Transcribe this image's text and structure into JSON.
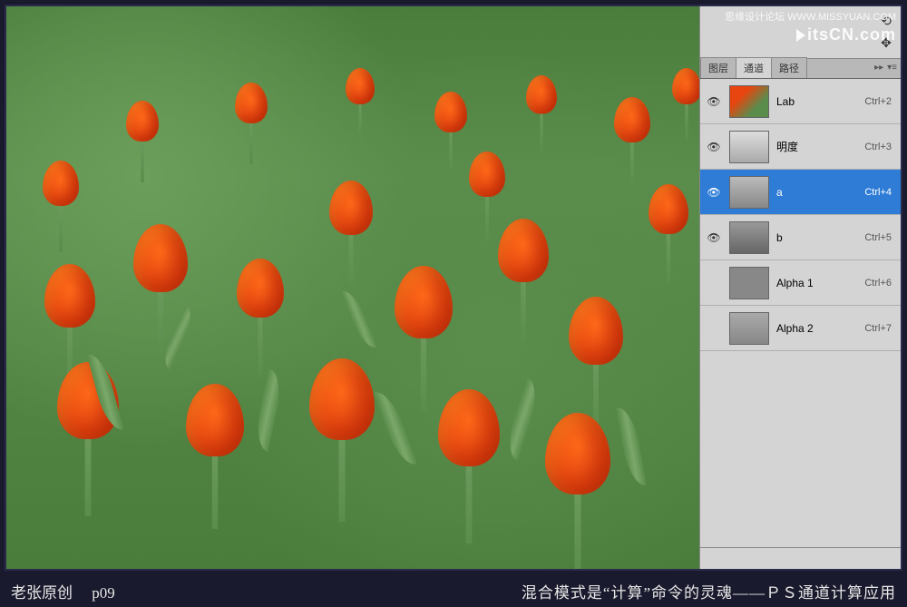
{
  "watermark": {
    "text": "思缘设计论坛 WWW.MISSYUAN.COM",
    "logo": "itsCN.com"
  },
  "tabs": {
    "layers": "图层",
    "channels": "通道",
    "paths": "路径"
  },
  "channels": [
    {
      "name": "Lab",
      "shortcut": "Ctrl+2",
      "visible": true,
      "selected": false,
      "thumb": "color"
    },
    {
      "name": "明度",
      "shortcut": "Ctrl+3",
      "visible": true,
      "selected": false,
      "thumb": "gray-light"
    },
    {
      "name": "a",
      "shortcut": "Ctrl+4",
      "visible": true,
      "selected": true,
      "thumb": "gray-mid"
    },
    {
      "name": "b",
      "shortcut": "Ctrl+5",
      "visible": true,
      "selected": false,
      "thumb": "gray-dark"
    },
    {
      "name": "Alpha 1",
      "shortcut": "Ctrl+6",
      "visible": false,
      "selected": false,
      "thumb": "gray-flat"
    },
    {
      "name": "Alpha 2",
      "shortcut": "Ctrl+7",
      "visible": false,
      "selected": false,
      "thumb": "gray-tex"
    }
  ],
  "footer": {
    "left_author": "老张原创",
    "left_page": "p09",
    "right_text": "混合模式是“计算”命令的灵魂——ＰＳ通道计算应用"
  }
}
